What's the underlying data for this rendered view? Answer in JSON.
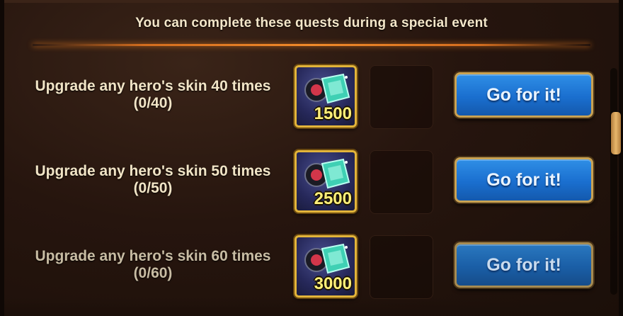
{
  "header": {
    "title": "You can complete these quests during a special event"
  },
  "quests": [
    {
      "description": "Upgrade any hero's skin 40 times",
      "progress": "(0/40)",
      "reward_amount": "1500",
      "reward_icon": "skin-stone-icon",
      "button_label": "Go for it!"
    },
    {
      "description": "Upgrade any hero's skin 50 times",
      "progress": "(0/50)",
      "reward_amount": "2500",
      "reward_icon": "skin-stone-icon",
      "button_label": "Go for it!"
    },
    {
      "description": "Upgrade any hero's skin 60 times",
      "progress": "(0/60)",
      "reward_amount": "3000",
      "reward_icon": "skin-stone-icon",
      "button_label": "Go for it!"
    }
  ],
  "colors": {
    "accent_orange": "#f08a2a",
    "button_blue": "#1a6fcf",
    "reward_border_gold": "#e2b43a",
    "reward_amount_yellow": "#fff07a"
  }
}
